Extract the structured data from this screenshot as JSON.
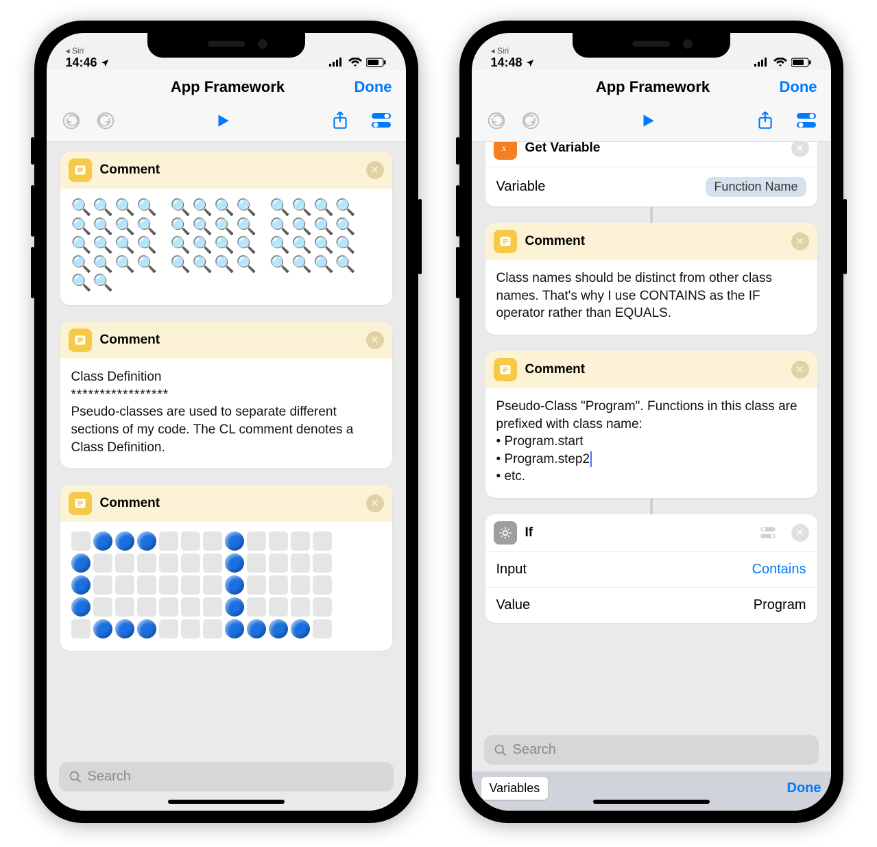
{
  "left": {
    "status": {
      "time": "14:46",
      "siri_back": "◂ Siri"
    },
    "nav": {
      "title": "App Framework",
      "done": "Done"
    },
    "search": {
      "placeholder": "Search"
    },
    "cards": {
      "comment1": {
        "title": "Comment",
        "art": "🔍🔍🔍🔍  🔍🔍🔍🔍  🔍🔍🔍🔍\n🔍🔍🔍🔍  🔍🔍🔍🔍  🔍🔍🔍🔍\n🔍🔍🔍🔍  🔍🔍🔍🔍  🔍🔍🔍🔍\n🔍🔍🔍🔍  🔍🔍🔍🔍  🔍🔍🔍🔍\n🔍🔍"
      },
      "comment2": {
        "title": "Comment",
        "body_heading": "Class Definition",
        "body_rule": "*****************",
        "body_text": "Pseudo-classes are used to separate different sections of my code. The CL comment denotes a Class Definition."
      },
      "comment3": {
        "title": "Comment",
        "pixel_pattern": [
          " bbb   b    ",
          "b      b    ",
          "b      b    ",
          "b      b    ",
          " bbb   bbbb "
        ]
      }
    }
  },
  "right": {
    "status": {
      "time": "14:48",
      "siri_back": "◂ Siri"
    },
    "nav": {
      "title": "App Framework",
      "done": "Done"
    },
    "search": {
      "placeholder": "Search"
    },
    "getvar": {
      "title": "Get Variable",
      "field_label": "Variable",
      "field_value": "Function Name"
    },
    "comment1": {
      "title": "Comment",
      "body": "Class names should be distinct from other class names. That's why I use CONTAINS as the IF operator rather than EQUALS."
    },
    "comment2": {
      "title": "Comment",
      "body_intro": "Pseudo-Class \"Program\". Functions in this class are prefixed with class name:",
      "bullets": [
        "Program.start",
        "Program.step2",
        "etc."
      ]
    },
    "ifcard": {
      "title": "If",
      "input_label": "Input",
      "input_value": "Contains",
      "value_label": "Value",
      "value_value": "Program"
    },
    "kb": {
      "chip": "Variables",
      "done": "Done"
    }
  }
}
